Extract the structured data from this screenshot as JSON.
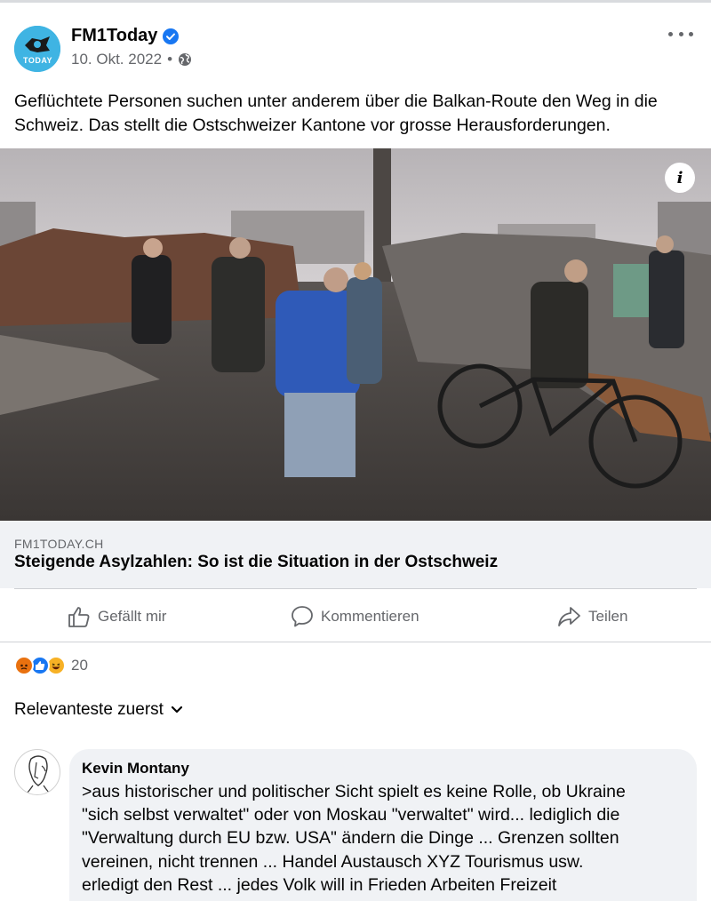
{
  "post": {
    "author": "FM1Today",
    "avatar_text": "TODAY",
    "date": "10. Okt. 2022",
    "separator": "•",
    "text": "Geflüchtete Personen suchen unter anderem über die Balkan-Route den Weg in die Schweiz. Das stellt die Ostschweizer Kantone vor grosse Herausforderungen."
  },
  "link_preview": {
    "domain": "FM1TODAY.CH",
    "title": "Steigende Asylzahlen: So ist die Situation in der Ostschweiz",
    "info_glyph": "i"
  },
  "actions": {
    "like": "Gefällt mir",
    "comment": "Kommentieren",
    "share": "Teilen"
  },
  "reactions": {
    "count": "20",
    "icons": [
      "angry-reaction-icon",
      "like-reaction-icon",
      "haha-reaction-icon"
    ]
  },
  "sort": {
    "label": "Relevanteste zuerst"
  },
  "comment": {
    "author": "Kevin Montany",
    "lines": [
      ">aus historischer und politischer Sicht spielt es keine Rolle, ob Ukraine",
      "\"sich selbst verwaltet\" oder von Moskau \"verwaltet\" wird... lediglich die",
      "\"Verwaltung durch EU bzw. USA\" ändern die Dinge ... Grenzen sollten",
      "vereinen, nicht trennen ... Handel Austausch XYZ Tourismus usw.",
      "erledigt den Rest ... jedes  Volk will in Frieden Arbeiten Freizeit"
    ]
  },
  "colors": {
    "brand_blue": "#1877f2",
    "secondary_text": "#65676b",
    "link_box_bg": "#f0f2f5",
    "avatar_bg": "#3fb4e3"
  }
}
